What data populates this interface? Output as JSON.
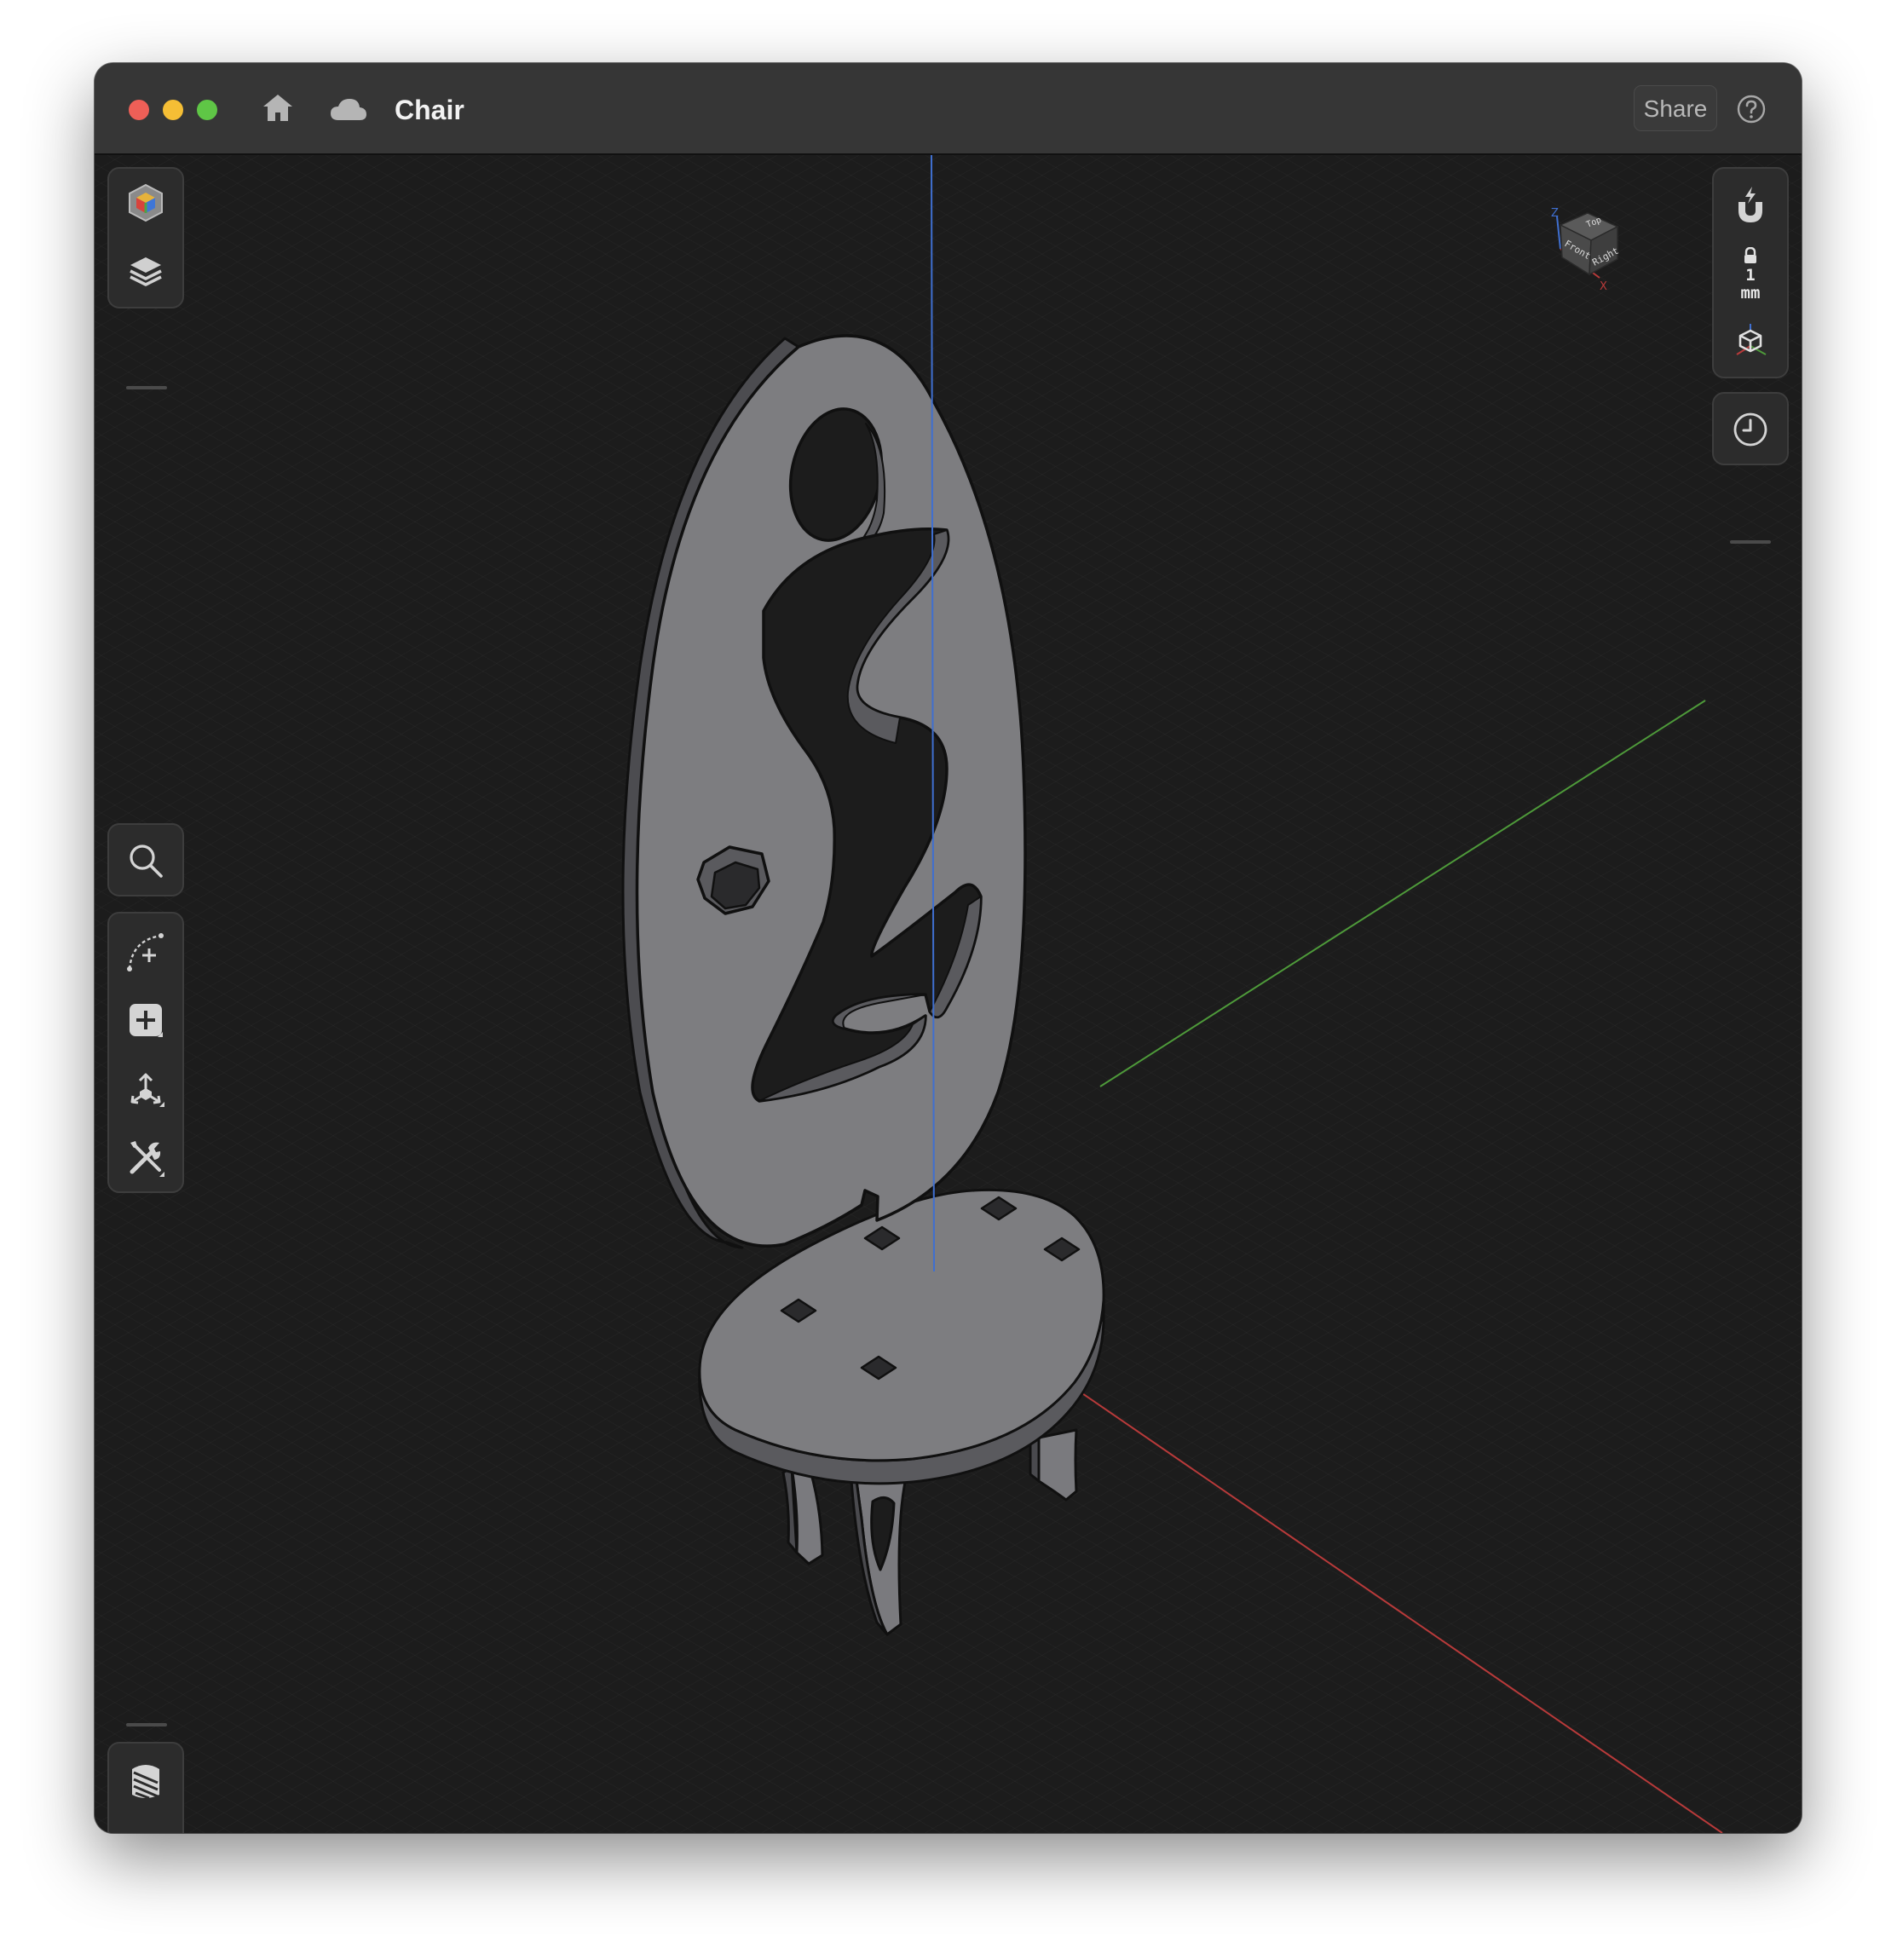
{
  "window": {
    "title": "Chair",
    "share_label": "Share"
  },
  "icons": {
    "home": "home-icon",
    "cloud": "cloud-icon",
    "help": "help-icon"
  },
  "left_toolbar": {
    "top": [
      "appearance-cube-icon",
      "layers-icon"
    ],
    "search": "search-icon",
    "tools": [
      "sketch-arc-icon",
      "add-primitive-icon",
      "transform-icon",
      "modify-tools-icon"
    ],
    "bottom": [
      "slice-icon",
      "measure-icon"
    ]
  },
  "right_toolbar": {
    "snap_value": "1",
    "snap_unit": "mm",
    "items": [
      "magnet-icon",
      "lock-icon",
      "view-cube-icon",
      "history-icon"
    ]
  },
  "view_cube": {
    "top": "Top",
    "front": "Front",
    "right": "Right",
    "z_axis": "Z",
    "x_axis": "X"
  },
  "colors": {
    "titlebar": "#363636",
    "viewport": "#1c1c1c",
    "panel": "#2c2c2c",
    "axis_x": "#b83a3a",
    "axis_y": "#4e9a3a",
    "axis_z": "#3f6fd0",
    "model": "#7d7d80"
  }
}
